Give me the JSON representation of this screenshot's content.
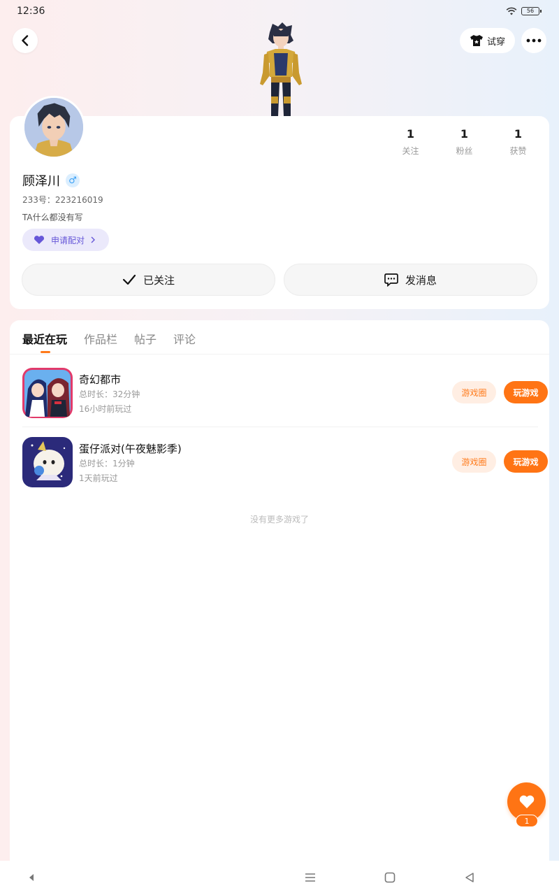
{
  "status": {
    "time": "12:36",
    "battery": "56"
  },
  "header": {
    "tryon_label": "试穿"
  },
  "profile": {
    "name": "顾泽川",
    "gender_symbol": "♂",
    "id_text": "233号：223216019",
    "bio": "TA什么都没有写",
    "pair_label": "申请配对",
    "stats": [
      {
        "value": "1",
        "label": "关注"
      },
      {
        "value": "1",
        "label": "粉丝"
      },
      {
        "value": "1",
        "label": "获赞"
      }
    ],
    "follow_label": "已关注",
    "message_label": "发消息"
  },
  "tabs": [
    {
      "label": "最近在玩",
      "active": true
    },
    {
      "label": "作品栏",
      "active": false
    },
    {
      "label": "帖子",
      "active": false
    },
    {
      "label": "评论",
      "active": false
    }
  ],
  "games": [
    {
      "name": "奇幻都市",
      "duration": "总时长：32分钟",
      "last_played": "16小时前玩过",
      "circle_label": "游戏圈",
      "play_label": "玩游戏"
    },
    {
      "name": "蛋仔派对(午夜魅影季)",
      "duration": "总时长：1分钟",
      "last_played": "1天前玩过",
      "circle_label": "游戏圈",
      "play_label": "玩游戏"
    }
  ],
  "list_footer": "没有更多游戏了",
  "like": {
    "count": "1"
  },
  "colors": {
    "accent": "#ff7414",
    "pair_text": "#6657d8"
  }
}
